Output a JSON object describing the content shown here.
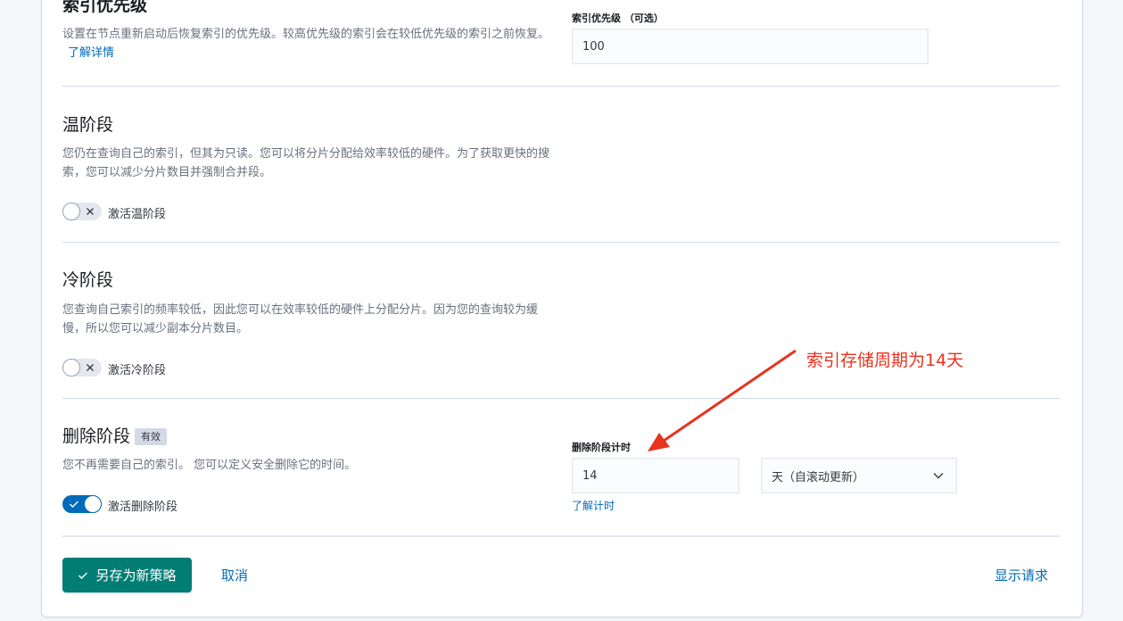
{
  "index_priority": {
    "title": "索引优先级",
    "description": "设置在节点重新启动后恢复索引的优先级。较高优先级的索引会在较低优先级的索引之前恢复。",
    "learn_more": "了解详情",
    "field_label": "索引优先级 （可选）",
    "value": "100"
  },
  "warm_phase": {
    "title": "温阶段",
    "description": "您仍在查询自己的索引，但其为只读。您可以将分片分配给效率较低的硬件。为了获取更快的搜索，您可以减少分片数目并强制合并段。",
    "toggle_label": "激活温阶段",
    "enabled": false
  },
  "cold_phase": {
    "title": "冷阶段",
    "description": "您查询自己索引的频率较低，因此您可以在效率较低的硬件上分配分片。因为您的查询较为缓慢，所以您可以减少副本分片数目。",
    "toggle_label": "激活冷阶段",
    "enabled": false
  },
  "delete_phase": {
    "title": "删除阶段",
    "badge": "有效",
    "description": "您不再需要自己的索引。 您可以定义安全删除它的时间。",
    "toggle_label": "激活删除阶段",
    "enabled": true,
    "timing_label": "删除阶段计时",
    "timing_value": "14",
    "unit_selected": "天（自滚动更新）",
    "learn_timing": "了解计时"
  },
  "annotation": {
    "text": "索引存储周期为14天",
    "color": "#e8331e"
  },
  "footer": {
    "save_as_new": "另存为新策略",
    "cancel": "取消",
    "show_request": "显示请求"
  },
  "colors": {
    "primary_button": "#017d73",
    "link": "#006bb8",
    "switch_on": "#006bb8"
  }
}
